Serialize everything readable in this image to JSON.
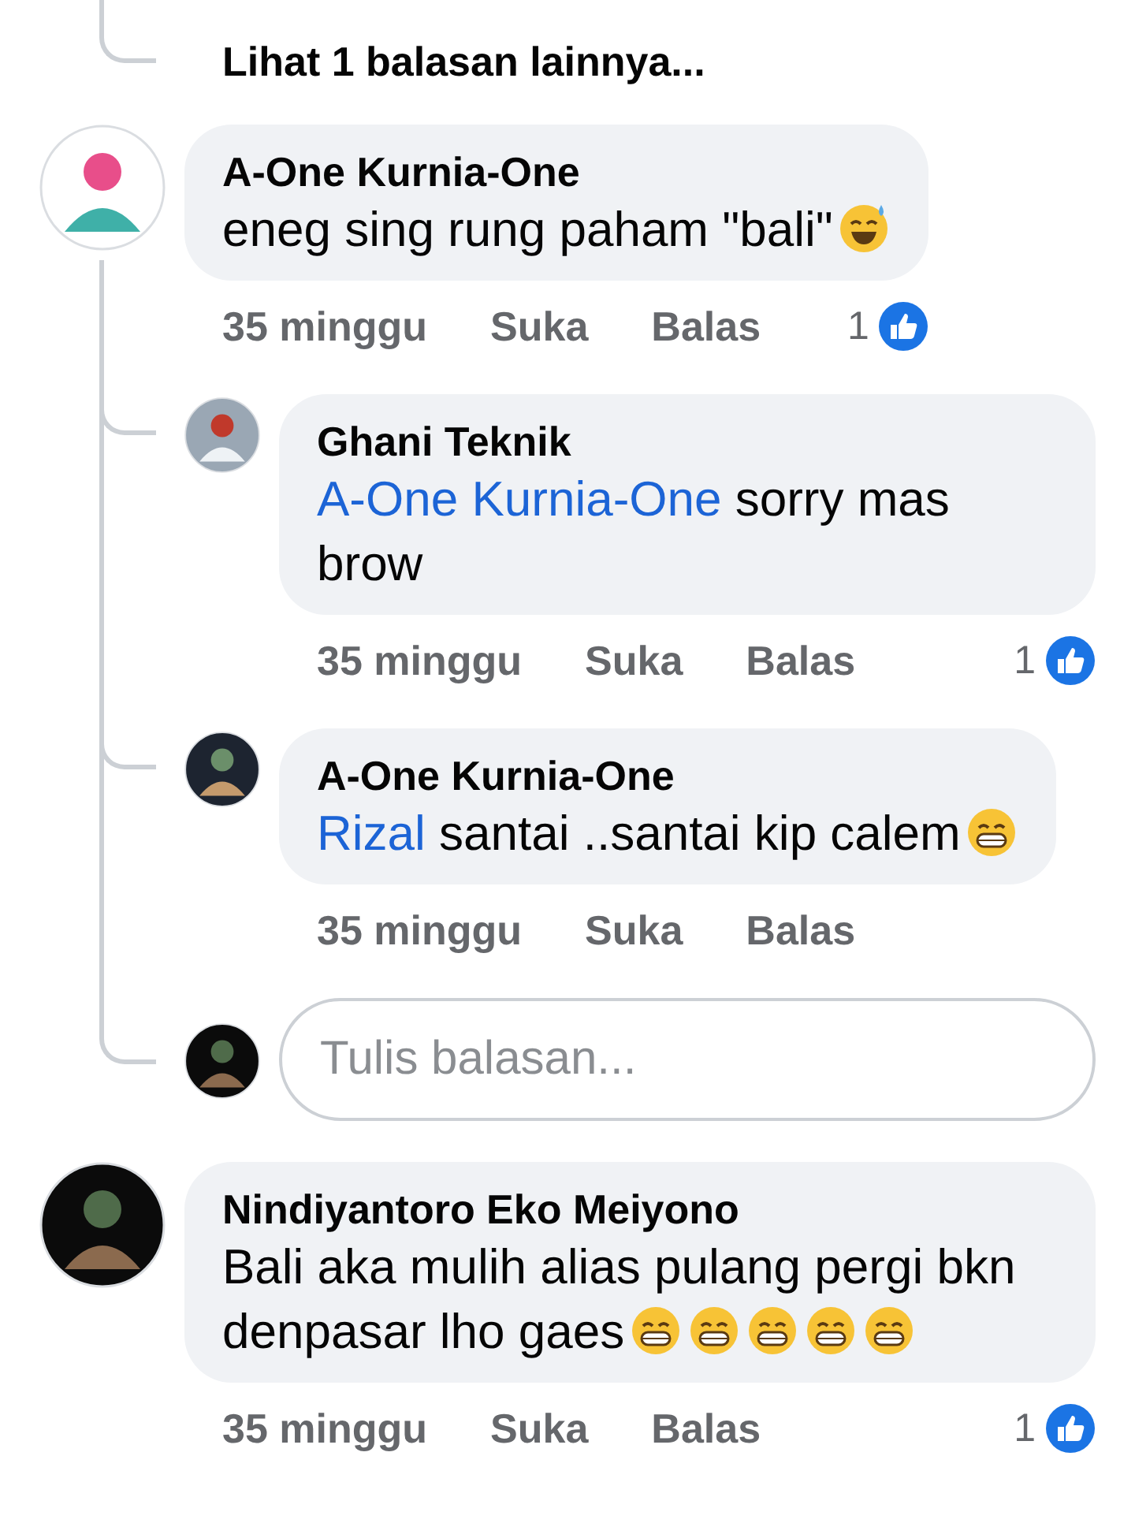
{
  "more_replies_link": "Lihat 1 balasan lainnya...",
  "comments": [
    {
      "author": "A-One Kurnia-One",
      "text": "eneg sing rung paham \"bali\"",
      "emojis": [
        {
          "kind": "sweat-smile"
        }
      ],
      "time": "35 minggu",
      "like_action": "Suka",
      "reply_action": "Balas",
      "likes": "1",
      "replies": [
        {
          "author": "Ghani Teknik",
          "mention": "A-One Kurnia-One",
          "text": "sorry mas brow",
          "time": "35 minggu",
          "like_action": "Suka",
          "reply_action": "Balas",
          "likes": "1"
        },
        {
          "author": "A-One Kurnia-One",
          "mention": "Rizal",
          "text": "santai ..santai kip calem",
          "emojis": [
            {
              "kind": "grin"
            }
          ],
          "time": "35 minggu",
          "like_action": "Suka",
          "reply_action": "Balas"
        }
      ],
      "reply_field": {
        "placeholder": "Tulis balasan..."
      }
    },
    {
      "author": "Nindiyantoro Eko Meiyono",
      "text": "Bali aka mulih alias pulang pergi bkn denpasar lho gaes",
      "emojis": [
        {
          "kind": "grin"
        },
        {
          "kind": "grin"
        },
        {
          "kind": "grin"
        },
        {
          "kind": "grin"
        },
        {
          "kind": "grin"
        }
      ],
      "time": "35 minggu",
      "like_action": "Suka",
      "reply_action": "Balas",
      "likes": "1"
    }
  ]
}
